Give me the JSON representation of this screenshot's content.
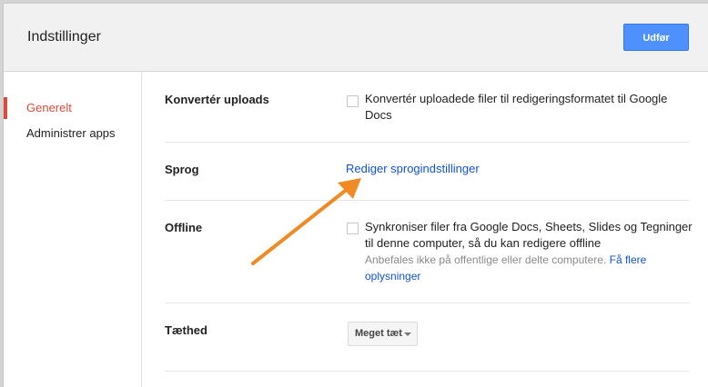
{
  "header": {
    "title": "Indstillinger",
    "done_label": "Udfør"
  },
  "sidebar": {
    "items": [
      {
        "label": "Generelt",
        "active": true
      },
      {
        "label": "Administrer apps",
        "active": false
      }
    ]
  },
  "settings": {
    "convert": {
      "label": "Konvertér uploads",
      "option": "Konvertér uploadede filer til redigeringsformatet til Google Docs",
      "checked": false
    },
    "language": {
      "label": "Sprog",
      "link": "Rediger sprogindstillinger"
    },
    "offline": {
      "label": "Offline",
      "option": "Synkroniser filer fra Google Docs, Sheets, Slides og Tegninger til denne computer, så du kan redigere offline",
      "hint": "Anbefales ikke på offentlige eller delte computere.",
      "hint_link": "Få flere oplysninger",
      "checked": false
    },
    "density": {
      "label": "Tæthed",
      "selected": "Meget tæt"
    }
  },
  "colors": {
    "accent_active": "#dd4b39",
    "button_blue": "#4d90fe",
    "link_blue": "#1155cc",
    "annotation_arrow": "#f08a24"
  },
  "annotation": {
    "icon": "arrow-icon"
  }
}
